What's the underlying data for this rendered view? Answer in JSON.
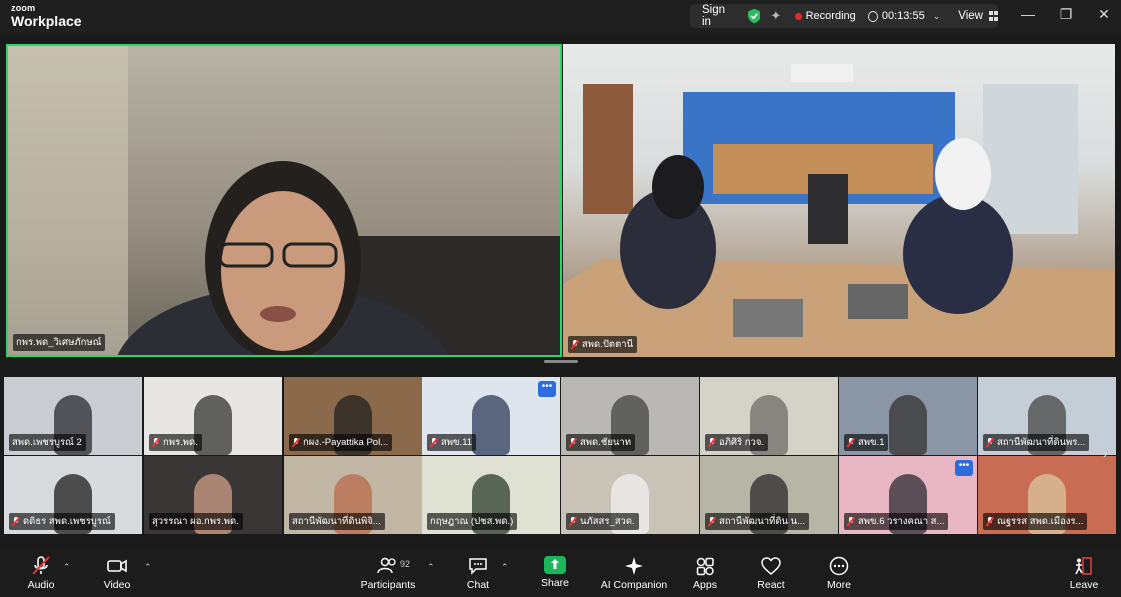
{
  "app": {
    "logo_top": "zoom",
    "logo_bottom": "Workplace"
  },
  "header": {
    "sign_in": "Sign in",
    "recording_label": "Recording",
    "timer": "00:13:55",
    "view_label": "View"
  },
  "colors": {
    "active_speaker": "#2bd56a",
    "recording": "#e02828",
    "share": "#1cb75a",
    "leave": "#e23b3b"
  },
  "main_tiles": [
    {
      "name": "กพร.พด_วิเศษภักษณ์"
    },
    {
      "name": "สพด.ปัตตานี"
    }
  ],
  "gallery": [
    {
      "name": "สพด.เพชรบูรณ์ 2"
    },
    {
      "name": "กพร.พด."
    },
    {
      "name": "กผง.-Payattika Pol..."
    },
    {
      "name": "สพข.11"
    },
    {
      "name": "สพด.ชัยนาท"
    },
    {
      "name": "อภิศิริ กวจ."
    },
    {
      "name": "สพข.1"
    },
    {
      "name": "สถานีพัฒนาที่ดินพร..."
    },
    {
      "name": "ดดิธร สพด.เพชรบูรณ์"
    },
    {
      "name": "สุวรรณา ผอ.กพร.พด."
    },
    {
      "name": "สถานีพัฒนาที่ดินพิจิ..."
    },
    {
      "name": "กฤษฎาณ (ปชส.พด.)"
    },
    {
      "name": "นภัสสร_สวด."
    },
    {
      "name": "สถานีพัฒนาที่ดิน น..."
    },
    {
      "name": "สพข.6 วรางคณา ส..."
    },
    {
      "name": "ณฐรรส สพด.เมืองร..."
    }
  ],
  "toolbar": {
    "audio": "Audio",
    "video": "Video",
    "participants": "Participants",
    "participants_count": "92",
    "chat": "Chat",
    "share": "Share",
    "ai_companion": "AI Companion",
    "apps": "Apps",
    "react": "React",
    "more": "More",
    "leave": "Leave"
  }
}
